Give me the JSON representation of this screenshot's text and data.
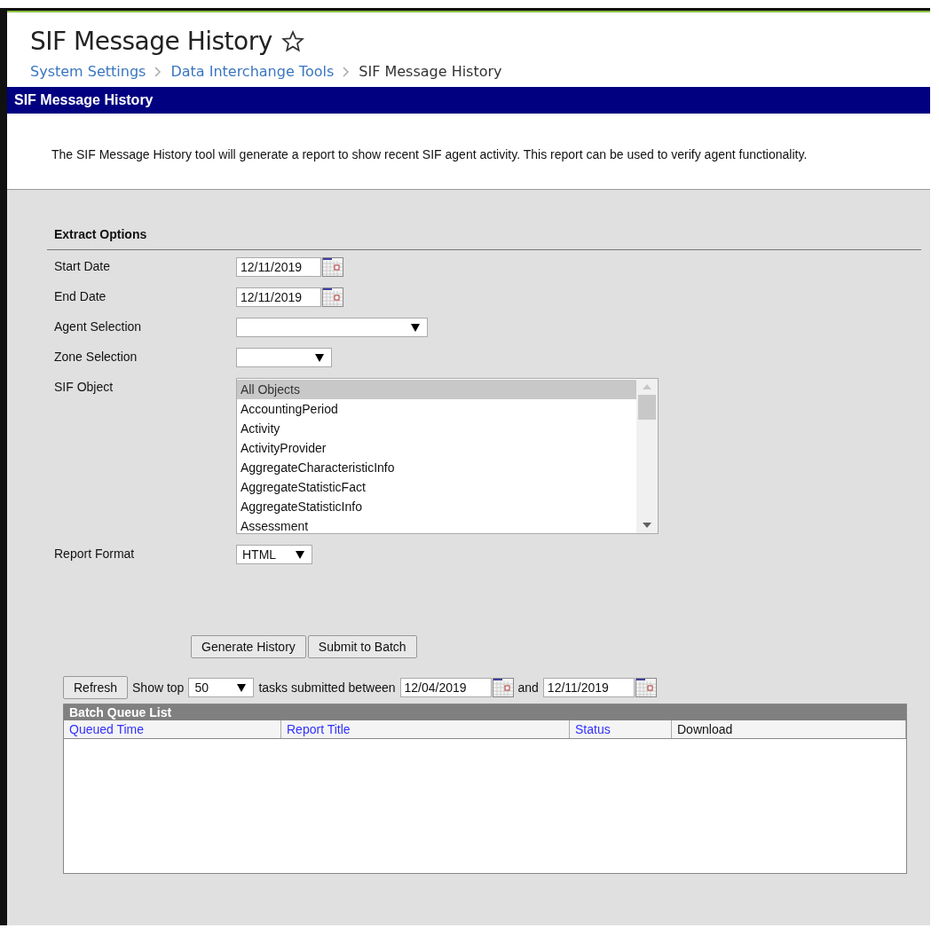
{
  "page": {
    "title": "SIF Message History",
    "favorite": false
  },
  "breadcrumbs": [
    {
      "label": "System Settings",
      "link": true
    },
    {
      "label": "Data Interchange Tools",
      "link": true
    },
    {
      "label": "SIF Message History",
      "link": false
    }
  ],
  "panel": {
    "title": "SIF Message History",
    "description": "The SIF Message History tool will generate a report to show recent SIF agent activity. This report can be used to verify agent functionality."
  },
  "extract_options": {
    "title": "Extract Options",
    "fields": [
      {
        "kind": "date",
        "label": "Start Date",
        "value": "12/11/2019"
      },
      {
        "kind": "date",
        "label": "End Date",
        "value": "12/11/2019"
      },
      {
        "kind": "select",
        "label": "Agent Selection"
      },
      {
        "kind": "select",
        "label": "Zone Selection"
      },
      {
        "kind": "listbox",
        "label": "SIF Object",
        "options": [
          {
            "label": "All Objects",
            "selected": true
          },
          {
            "label": "AccountingPeriod",
            "selected": false
          },
          {
            "label": "Activity",
            "selected": false
          },
          {
            "label": "ActivityProvider",
            "selected": false
          },
          {
            "label": "AggregateCharacteristicInfo",
            "selected": false
          },
          {
            "label": "AggregateStatisticFact",
            "selected": false
          },
          {
            "label": "AggregateStatisticInfo",
            "selected": false
          },
          {
            "label": "Assessment",
            "selected": false
          }
        ]
      },
      {
        "kind": "select",
        "label": "Report Format",
        "value": "HTML"
      }
    ]
  },
  "buttons": [
    "Generate History",
    "Submit to Batch"
  ],
  "batch": {
    "refresh": "Refresh",
    "show_top": "Show top",
    "top_value": "50",
    "between": "tasks submitted between",
    "from": "12/04/2019",
    "and": "and",
    "to": "12/11/2019",
    "title": "Batch Queue List",
    "columns": [
      {
        "label": "Queued Time",
        "sortable": true
      },
      {
        "label": "Report Title",
        "sortable": true
      },
      {
        "label": "Status",
        "sortable": true
      },
      {
        "label": "Download",
        "sortable": false
      }
    ]
  }
}
